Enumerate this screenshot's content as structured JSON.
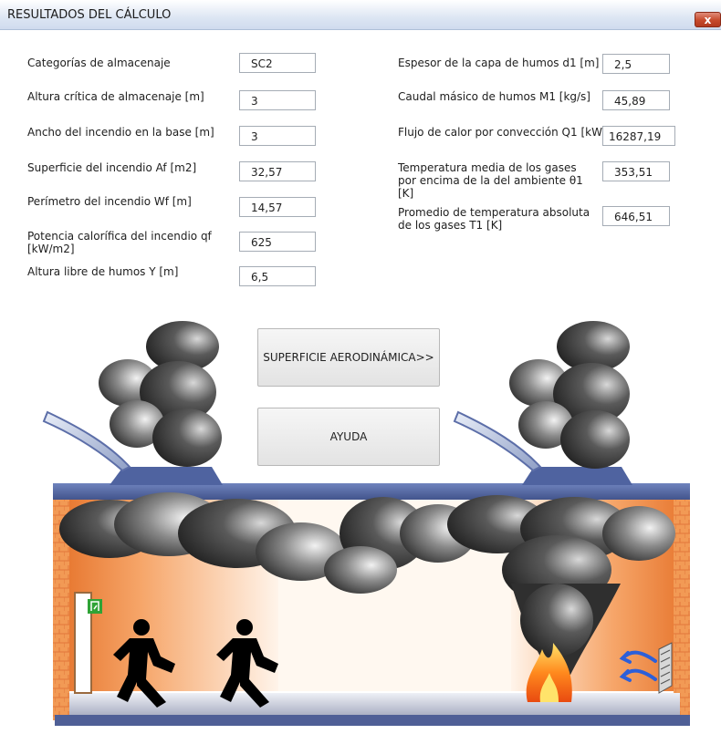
{
  "window": {
    "title": "RESULTADOS DEL CÁLCULO",
    "close_label": "x"
  },
  "left_fields": [
    {
      "label": "Categorías de almacenaje",
      "value": "SC2"
    },
    {
      "label": "Altura crítica de almacenaje [m]",
      "value": "3"
    },
    {
      "label": "Ancho del incendio en la base [m]",
      "value": "3"
    },
    {
      "label": "Superficie del incendio Af [m2]",
      "value": "32,57"
    },
    {
      "label": "Perímetro del incendio Wf [m]",
      "value": "14,57"
    },
    {
      "label": "Potencia calorífica del incendio qf [kW/m2]",
      "value": "625"
    },
    {
      "label": "Altura libre de humos Y [m]",
      "value": "6,5"
    }
  ],
  "right_fields": [
    {
      "label": "Espesor de la capa de humos d1 [m]",
      "value": "2,5"
    },
    {
      "label": "Caudal másico de humos M1 [kg/s]",
      "value": "45,89"
    },
    {
      "label": "Flujo de calor por convección Q1 [kW]",
      "value": "16287,19"
    },
    {
      "label": "Temperatura media de los gases por encima de la del ambiente  θ1 [K]",
      "value": "353,51"
    },
    {
      "label": "Promedio de temperatura absoluta de los gases T1 [K]",
      "value": "646,51"
    }
  ],
  "buttons": {
    "surface": "SUPERFICIE AERODINÁMICA>>",
    "help": "AYUDA"
  },
  "illustration": {
    "icons": [
      "smoke-vent-icon",
      "smoke-cloud-icon",
      "exit-sign-icon",
      "running-person-icon",
      "fire-icon",
      "airflow-icon"
    ],
    "colors": {
      "wall": "#f08a4a",
      "roof": "#5a6fa8",
      "floor": "#c4c9da",
      "smoke": "#3a3a3a",
      "fire": "#ff7a1a",
      "exit": "#2fa336"
    }
  }
}
